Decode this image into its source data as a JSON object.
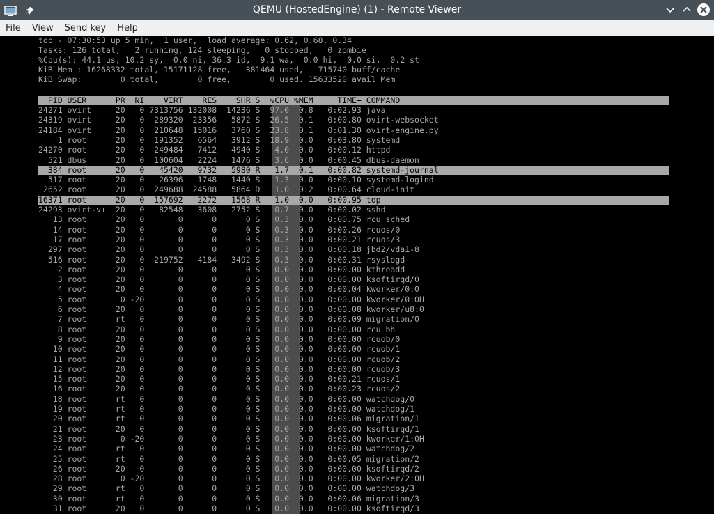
{
  "window": {
    "title": "QEMU (HostedEngine) (1) - Remote Viewer"
  },
  "menu": [
    "File",
    "View",
    "Send key",
    "Help"
  ],
  "summary": {
    "line1": "top - 07:30:53 up 5 min,  1 user,  load average: 0.62, 0.68, 0.34",
    "line2": "Tasks: 126 total,   2 running, 124 sleeping,   0 stopped,   0 zombie",
    "line3": "%Cpu(s): 44.1 us, 10.2 sy,  0.0 ni, 36.3 id,  9.1 wa,  0.0 hi,  0.0 si,  0.2 st",
    "line4": "KiB Mem : 16268332 total, 15171128 free,   381464 used,   715740 buff/cache",
    "line5": "KiB Swap:        0 total,        0 free,        0 used. 15633520 avail Mem"
  },
  "columns": "  PID USER      PR  NI    VIRT    RES    SHR S  %CPU %MEM     TIME+ COMMAND",
  "processes": [
    {
      "row": "24271 ovirt     20   0 7313756 132008  14236 S  97.0  0.8   0:02.93 java",
      "hl": false
    },
    {
      "row": "24319 ovirt     20   0  289320  23356   5872 S  26.5  0.1   0:00.80 ovirt-websocket",
      "hl": false
    },
    {
      "row": "24184 ovirt     20   0  210648  15016   3760 S  23.8  0.1   0:01.30 ovirt-engine.py",
      "hl": false
    },
    {
      "row": "    1 root      20   0  191352   6564   3912 S  18.9  0.0   0:03.80 systemd",
      "hl": false
    },
    {
      "row": "24270 root      20   0  249484   7412   4940 S   4.0  0.0   0:00.12 httpd",
      "hl": false
    },
    {
      "row": "  521 dbus      20   0  100604   2224   1476 S   3.6  0.0   0:00.45 dbus-daemon",
      "hl": false
    },
    {
      "row": "  384 root      20   0   45420   9732   5980 R   1.7  0.1   0:00.82 systemd-journal",
      "hl": true
    },
    {
      "row": "  517 root      20   0   26396   1748   1440 S   1.3  0.0   0:00.10 systemd-logind",
      "hl": false
    },
    {
      "row": " 2652 root      20   0  249688  24588   5864 D   1.0  0.2   0:00.64 cloud-init",
      "hl": false
    },
    {
      "row": "16371 root      20   0  157692   2272   1568 R   1.0  0.0   0:00.95 top",
      "hl": true
    },
    {
      "row": "24293 ovirt-v+  20   0   82548   3608   2752 S   0.7  0.0   0:00.02 sshd",
      "hl": false
    },
    {
      "row": "   13 root      20   0       0      0      0 S   0.3  0.0   0:00.75 rcu_sched",
      "hl": false
    },
    {
      "row": "   14 root      20   0       0      0      0 S   0.3  0.0   0:00.26 rcuos/0",
      "hl": false
    },
    {
      "row": "   17 root      20   0       0      0      0 S   0.3  0.0   0:00.21 rcuos/3",
      "hl": false
    },
    {
      "row": "  297 root      20   0       0      0      0 S   0.3  0.0   0:00.18 jbd2/vda1-8",
      "hl": false
    },
    {
      "row": "  516 root      20   0  219752   4184   3492 S   0.3  0.0   0:00.31 rsyslogd",
      "hl": false
    },
    {
      "row": "    2 root      20   0       0      0      0 S   0.0  0.0   0:00.00 kthreadd",
      "hl": false
    },
    {
      "row": "    3 root      20   0       0      0      0 S   0.0  0.0   0:00.00 ksoftirqd/0",
      "hl": false
    },
    {
      "row": "    4 root      20   0       0      0      0 S   0.0  0.0   0:00.04 kworker/0:0",
      "hl": false
    },
    {
      "row": "    5 root       0 -20       0      0      0 S   0.0  0.0   0:00.00 kworker/0:0H",
      "hl": false
    },
    {
      "row": "    6 root      20   0       0      0      0 S   0.0  0.0   0:00.08 kworker/u8:0",
      "hl": false
    },
    {
      "row": "    7 root      rt   0       0      0      0 S   0.0  0.0   0:00.09 migration/0",
      "hl": false
    },
    {
      "row": "    8 root      20   0       0      0      0 S   0.0  0.0   0:00.00 rcu_bh",
      "hl": false
    },
    {
      "row": "    9 root      20   0       0      0      0 S   0.0  0.0   0:00.00 rcuob/0",
      "hl": false
    },
    {
      "row": "   10 root      20   0       0      0      0 S   0.0  0.0   0:00.00 rcuob/1",
      "hl": false
    },
    {
      "row": "   11 root      20   0       0      0      0 S   0.0  0.0   0:00.00 rcuob/2",
      "hl": false
    },
    {
      "row": "   12 root      20   0       0      0      0 S   0.0  0.0   0:00.00 rcuob/3",
      "hl": false
    },
    {
      "row": "   15 root      20   0       0      0      0 S   0.0  0.0   0:00.21 rcuos/1",
      "hl": false
    },
    {
      "row": "   16 root      20   0       0      0      0 S   0.0  0.0   0:00.23 rcuos/2",
      "hl": false
    },
    {
      "row": "   18 root      rt   0       0      0      0 S   0.0  0.0   0:00.00 watchdog/0",
      "hl": false
    },
    {
      "row": "   19 root      rt   0       0      0      0 S   0.0  0.0   0:00.00 watchdog/1",
      "hl": false
    },
    {
      "row": "   20 root      rt   0       0      0      0 S   0.0  0.0   0:00.06 migration/1",
      "hl": false
    },
    {
      "row": "   21 root      20   0       0      0      0 S   0.0  0.0   0:00.00 ksoftirqd/1",
      "hl": false
    },
    {
      "row": "   23 root       0 -20       0      0      0 S   0.0  0.0   0:00.00 kworker/1:0H",
      "hl": false
    },
    {
      "row": "   24 root      rt   0       0      0      0 S   0.0  0.0   0:00.00 watchdog/2",
      "hl": false
    },
    {
      "row": "   25 root      rt   0       0      0      0 S   0.0  0.0   0:00.05 migration/2",
      "hl": false
    },
    {
      "row": "   26 root      20   0       0      0      0 S   0.0  0.0   0:00.00 ksoftirqd/2",
      "hl": false
    },
    {
      "row": "   28 root       0 -20       0      0      0 S   0.0  0.0   0:00.00 kworker/2:0H",
      "hl": false
    },
    {
      "row": "   29 root      rt   0       0      0      0 S   0.0  0.0   0:00.00 watchdog/3",
      "hl": false
    },
    {
      "row": "   30 root      rt   0       0      0      0 S   0.0  0.0   0:00.06 migration/3",
      "hl": false
    },
    {
      "row": "   31 root      20   0       0      0      0 S   0.0  0.0   0:00.00 ksoftirqd/3",
      "hl": false
    }
  ],
  "icons": {
    "app": "monitor-icon",
    "pin": "pin-icon",
    "minimize": "chevron-down-icon",
    "maximize": "chevron-up-icon",
    "close": "close-icon"
  }
}
